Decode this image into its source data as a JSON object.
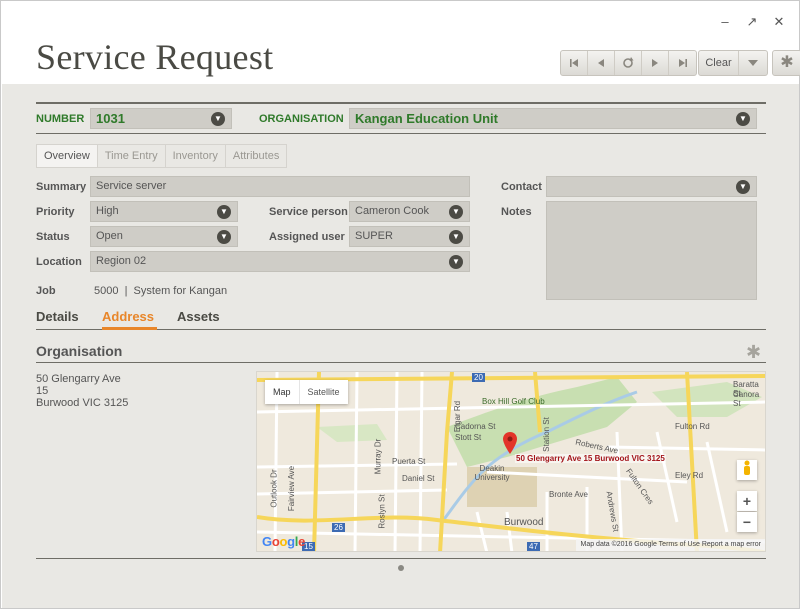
{
  "window": {
    "minimize_glyph": "–",
    "restore_glyph": "↗",
    "close_glyph": "✕"
  },
  "header": {
    "title": "Service Request",
    "nav_icons": [
      "first-record-icon",
      "previous-record-icon",
      "refresh-icon",
      "next-record-icon",
      "last-record-icon"
    ],
    "clear_label": "Clear",
    "star_glyph": "✱"
  },
  "record": {
    "number_label": "NUMBER",
    "number_value": "1031",
    "organisation_label": "ORGANISATION",
    "organisation_value": "Kangan Education Unit"
  },
  "subtabs": [
    "Overview",
    "Time Entry",
    "Inventory",
    "Attributes"
  ],
  "form": {
    "summary_label": "Summary",
    "summary_value": "Service server",
    "priority_label": "Priority",
    "priority_value": "High",
    "service_person_label": "Service person",
    "service_person_value": "Cameron Cook",
    "status_label": "Status",
    "status_value": "Open",
    "assigned_user_label": "Assigned user",
    "assigned_user_value": "SUPER",
    "location_label": "Location",
    "location_value": "Region 02",
    "job_label": "Job",
    "job_value": "5000  |  System for Kangan",
    "contact_label": "Contact",
    "contact_value": "",
    "notes_label": "Notes"
  },
  "tabs": [
    "Details",
    "Address",
    "Assets"
  ],
  "active_tab": "Address",
  "section": {
    "title": "Organisation",
    "address_lines": [
      "50 Glengarry Ave",
      "15",
      "Burwood VIC 3125"
    ]
  },
  "map": {
    "mode_map": "Map",
    "mode_satellite": "Satellite",
    "pin_label": "50 Glengarry Ave 15 Burwood VIC 3125",
    "place_labels": {
      "elgar_rd": "Elgar Rd",
      "station_st": "Station St",
      "box_hill_golf": "Box Hill Golf Club",
      "cadorna_st": "Cadorna St",
      "stott_st": "Stott St",
      "roberts_ave": "Roberts Ave",
      "fulton_rd": "Fulton Rd",
      "elgar_rd_2": "Elgar Rd",
      "puerta_st": "Puerta St",
      "daniel_st": "Daniel St",
      "murray_dr": "Murray Dr",
      "roslyn_st": "Roslyn St",
      "outlook_dr": "Outlook Dr",
      "fairview_ave": "Fairview Ave",
      "deakin_university": "Deakin University",
      "bronte_ave": "Bronte Ave",
      "fulton_cres": "Fulton Cres",
      "andrews_st": "Andrews St",
      "burwood": "Burwood",
      "ely_rd": "Eley Rd",
      "baratta_st": "Baratta St",
      "canora_st": "Canora St",
      "route_20": "20",
      "route_26": "26",
      "route_15": "15",
      "route_47": "47"
    },
    "zoom_in": "+",
    "zoom_out": "−",
    "footer": "Map data ©2016 Google   Terms of Use   Report a map error",
    "google": "Google"
  },
  "colors": {
    "accent": "#e8862a",
    "green": "#2f7a2a",
    "field": "#cfcdc7",
    "background": "#e9e8e4"
  }
}
